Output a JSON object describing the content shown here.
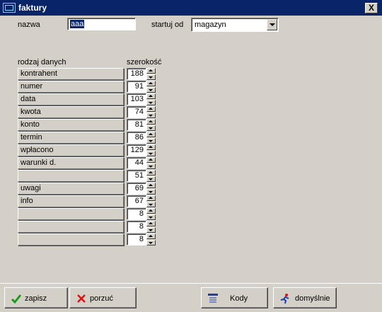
{
  "window": {
    "title": "faktury",
    "close_label": "X"
  },
  "form": {
    "name_label": "nazwa",
    "name_value": "aaa",
    "start_label": "startuj od",
    "start_value": "magazyn"
  },
  "table": {
    "col_type_header": "rodzaj danych",
    "col_width_header": "szerokość",
    "rows": [
      {
        "label": "kontrahent",
        "width": "188"
      },
      {
        "label": "numer",
        "width": "91"
      },
      {
        "label": "data",
        "width": "103"
      },
      {
        "label": "kwota",
        "width": "74"
      },
      {
        "label": "konto",
        "width": "81"
      },
      {
        "label": "termin",
        "width": "86"
      },
      {
        "label": "wpłacono",
        "width": "129"
      },
      {
        "label": "warunki d.",
        "width": "44"
      },
      {
        "label": "",
        "width": "51"
      },
      {
        "label": "uwagi",
        "width": "69"
      },
      {
        "label": "info",
        "width": "67"
      },
      {
        "label": "",
        "width": "8"
      },
      {
        "label": "",
        "width": "8"
      },
      {
        "label": "",
        "width": "8"
      }
    ]
  },
  "buttons": {
    "save": "zapisz",
    "cancel": "porzuć",
    "codes": "Kody",
    "defaults": "domyślnie"
  },
  "colors": {
    "titlebar": "#0a246a",
    "face": "#d4d0c8",
    "save_icon": "#1e9a1e",
    "cancel_icon": "#e01010"
  }
}
